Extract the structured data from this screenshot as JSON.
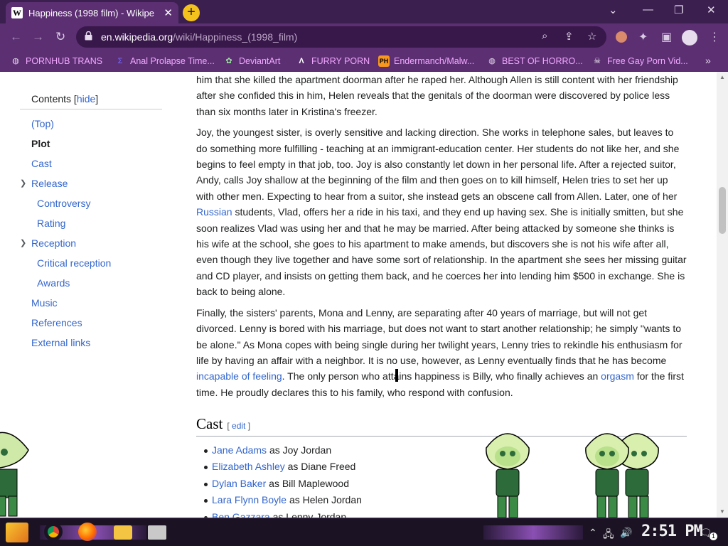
{
  "browser": {
    "tab_title": "Happiness (1998 film) - Wikipe",
    "tab_favicon": "W",
    "new_tab": "+",
    "url_domain": "en.wikipedia.org",
    "url_path": "/wiki/Happiness_(1998_film)",
    "theme_color": "#5c2f73"
  },
  "bookmarks": [
    {
      "label": "PORNHUB TRANS",
      "icon": "globe-icon"
    },
    {
      "label": "Anal Prolapse Time...",
      "icon": "bookmark-icon"
    },
    {
      "label": "DeviantArt",
      "icon": "deviantart-icon"
    },
    {
      "label": "FURRY PORN",
      "icon": "lambda-icon"
    },
    {
      "label": "Endermanch/Malw...",
      "icon": "ph-icon"
    },
    {
      "label": "BEST OF HORRO...",
      "icon": "globe-icon"
    },
    {
      "label": "Free Gay Porn Vid...",
      "icon": "skull-icon"
    }
  ],
  "toc": {
    "title": "Contents",
    "hide_label": "hide",
    "items": [
      {
        "label": "(Top)",
        "level": 1
      },
      {
        "label": "Plot",
        "level": 1,
        "active": true
      },
      {
        "label": "Cast",
        "level": 1
      },
      {
        "label": "Release",
        "level": 1,
        "expandable": true
      },
      {
        "label": "Controversy",
        "level": 2
      },
      {
        "label": "Rating",
        "level": 2
      },
      {
        "label": "Reception",
        "level": 1,
        "expandable": true
      },
      {
        "label": "Critical reception",
        "level": 2
      },
      {
        "label": "Awards",
        "level": 2
      },
      {
        "label": "Music",
        "level": 1
      },
      {
        "label": "References",
        "level": 1
      },
      {
        "label": "External links",
        "level": 1
      }
    ]
  },
  "article": {
    "p1": "him that she killed the apartment doorman after he raped her. Although Allen is still content with her friendship after she confided this in him, Helen reveals that the genitals of the doorman were discovered by police less than six months later in Kristina's freezer.",
    "p2_a": "Joy, the youngest sister, is overly sensitive and lacking direction. She works in telephone sales, but leaves to do something more fulfilling - teaching at an immigrant-education center. Her students do not like her, and she begins to feel empty in that job, too. Joy is also constantly let down in her personal life. After a rejected suitor, Andy, calls Joy shallow at the beginning of the film and then goes on to kill himself, Helen tries to set her up with other men. Expecting to hear from a suitor, she instead gets an obscene call from Allen. Later, one of her ",
    "p2_link": "Russian",
    "p2_b": " students, Vlad, offers her a ride in his taxi, and they end up having sex. She is initially smitten, but she soon realizes Vlad was using her and that he may be married. After being attacked by someone she thinks is his wife at the school, she goes to his apartment to make amends, but discovers she is not his wife after all, even though they live together and have some sort of relationship. In the apartment she sees her missing guitar and CD player, and insists on getting them back, and he coerces her into lending him $500 in exchange. She is back to being alone.",
    "p3_a": "Finally, the sisters' parents, Mona and Lenny, are separating after 40 years of marriage, but will not get divorced. Lenny is bored with his marriage, but does not want to start another relationship; he simply \"wants to be alone.\" As Mona copes with being single during her twilight years, Lenny tries to rekindle his enthusiasm for life by having an affair with a neighbor. It is no use, however, as Lenny eventually finds that he has become ",
    "p3_link1": "incapable of feeling",
    "p3_b": ". The only person who attains happiness is Billy, who finally achieves an ",
    "p3_link2": "orgasm",
    "p3_c": " for the first time. He proudly declares this to his family, who respond with confusion.",
    "cast_heading": "Cast",
    "edit_label": "edit",
    "cast": [
      {
        "actor": "Jane Adams",
        "role": " as Joy Jordan"
      },
      {
        "actor": "Elizabeth Ashley",
        "role": " as Diane Freed"
      },
      {
        "actor": "Dylan Baker",
        "role": " as Bill Maplewood"
      },
      {
        "actor": "Lara Flynn Boyle",
        "role": " as Helen Jordan"
      },
      {
        "actor": "Ben Gazzara",
        "role": " as Lenny Jordan"
      }
    ]
  },
  "taskbar": {
    "clock": "2:51 PM",
    "notification_count": "1",
    "apps": [
      "chrome-icon",
      "firefox-icon",
      "file-explorer-icon",
      "window-icon"
    ]
  }
}
